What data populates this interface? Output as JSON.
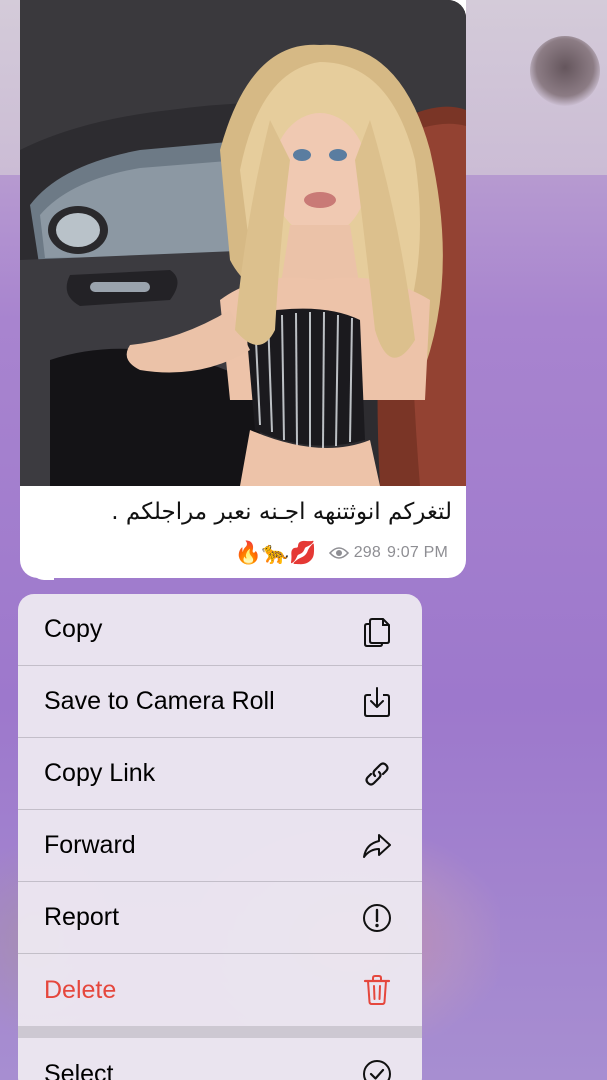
{
  "message": {
    "caption": "لتغركم انوثتنهه اجـنه نعبر مراجلكم .",
    "emojis": "🔥🐆💋",
    "views": "298",
    "time": "9:07 PM"
  },
  "context_menu": {
    "items": [
      {
        "label": "Copy",
        "icon": "copy-icon"
      },
      {
        "label": "Save to Camera Roll",
        "icon": "download-icon"
      },
      {
        "label": "Copy Link",
        "icon": "link-icon"
      },
      {
        "label": "Forward",
        "icon": "forward-arrow-icon"
      },
      {
        "label": "Report",
        "icon": "exclamation-circle-icon"
      },
      {
        "label": "Delete",
        "icon": "trash-icon"
      }
    ],
    "secondary_items": [
      {
        "label": "Select",
        "icon": "check-circle-icon"
      }
    ]
  },
  "colors": {
    "destructive": "#e5473d",
    "background_purple": "#a884cf",
    "bubble": "#ffffff",
    "menu": "#ece7f0"
  }
}
